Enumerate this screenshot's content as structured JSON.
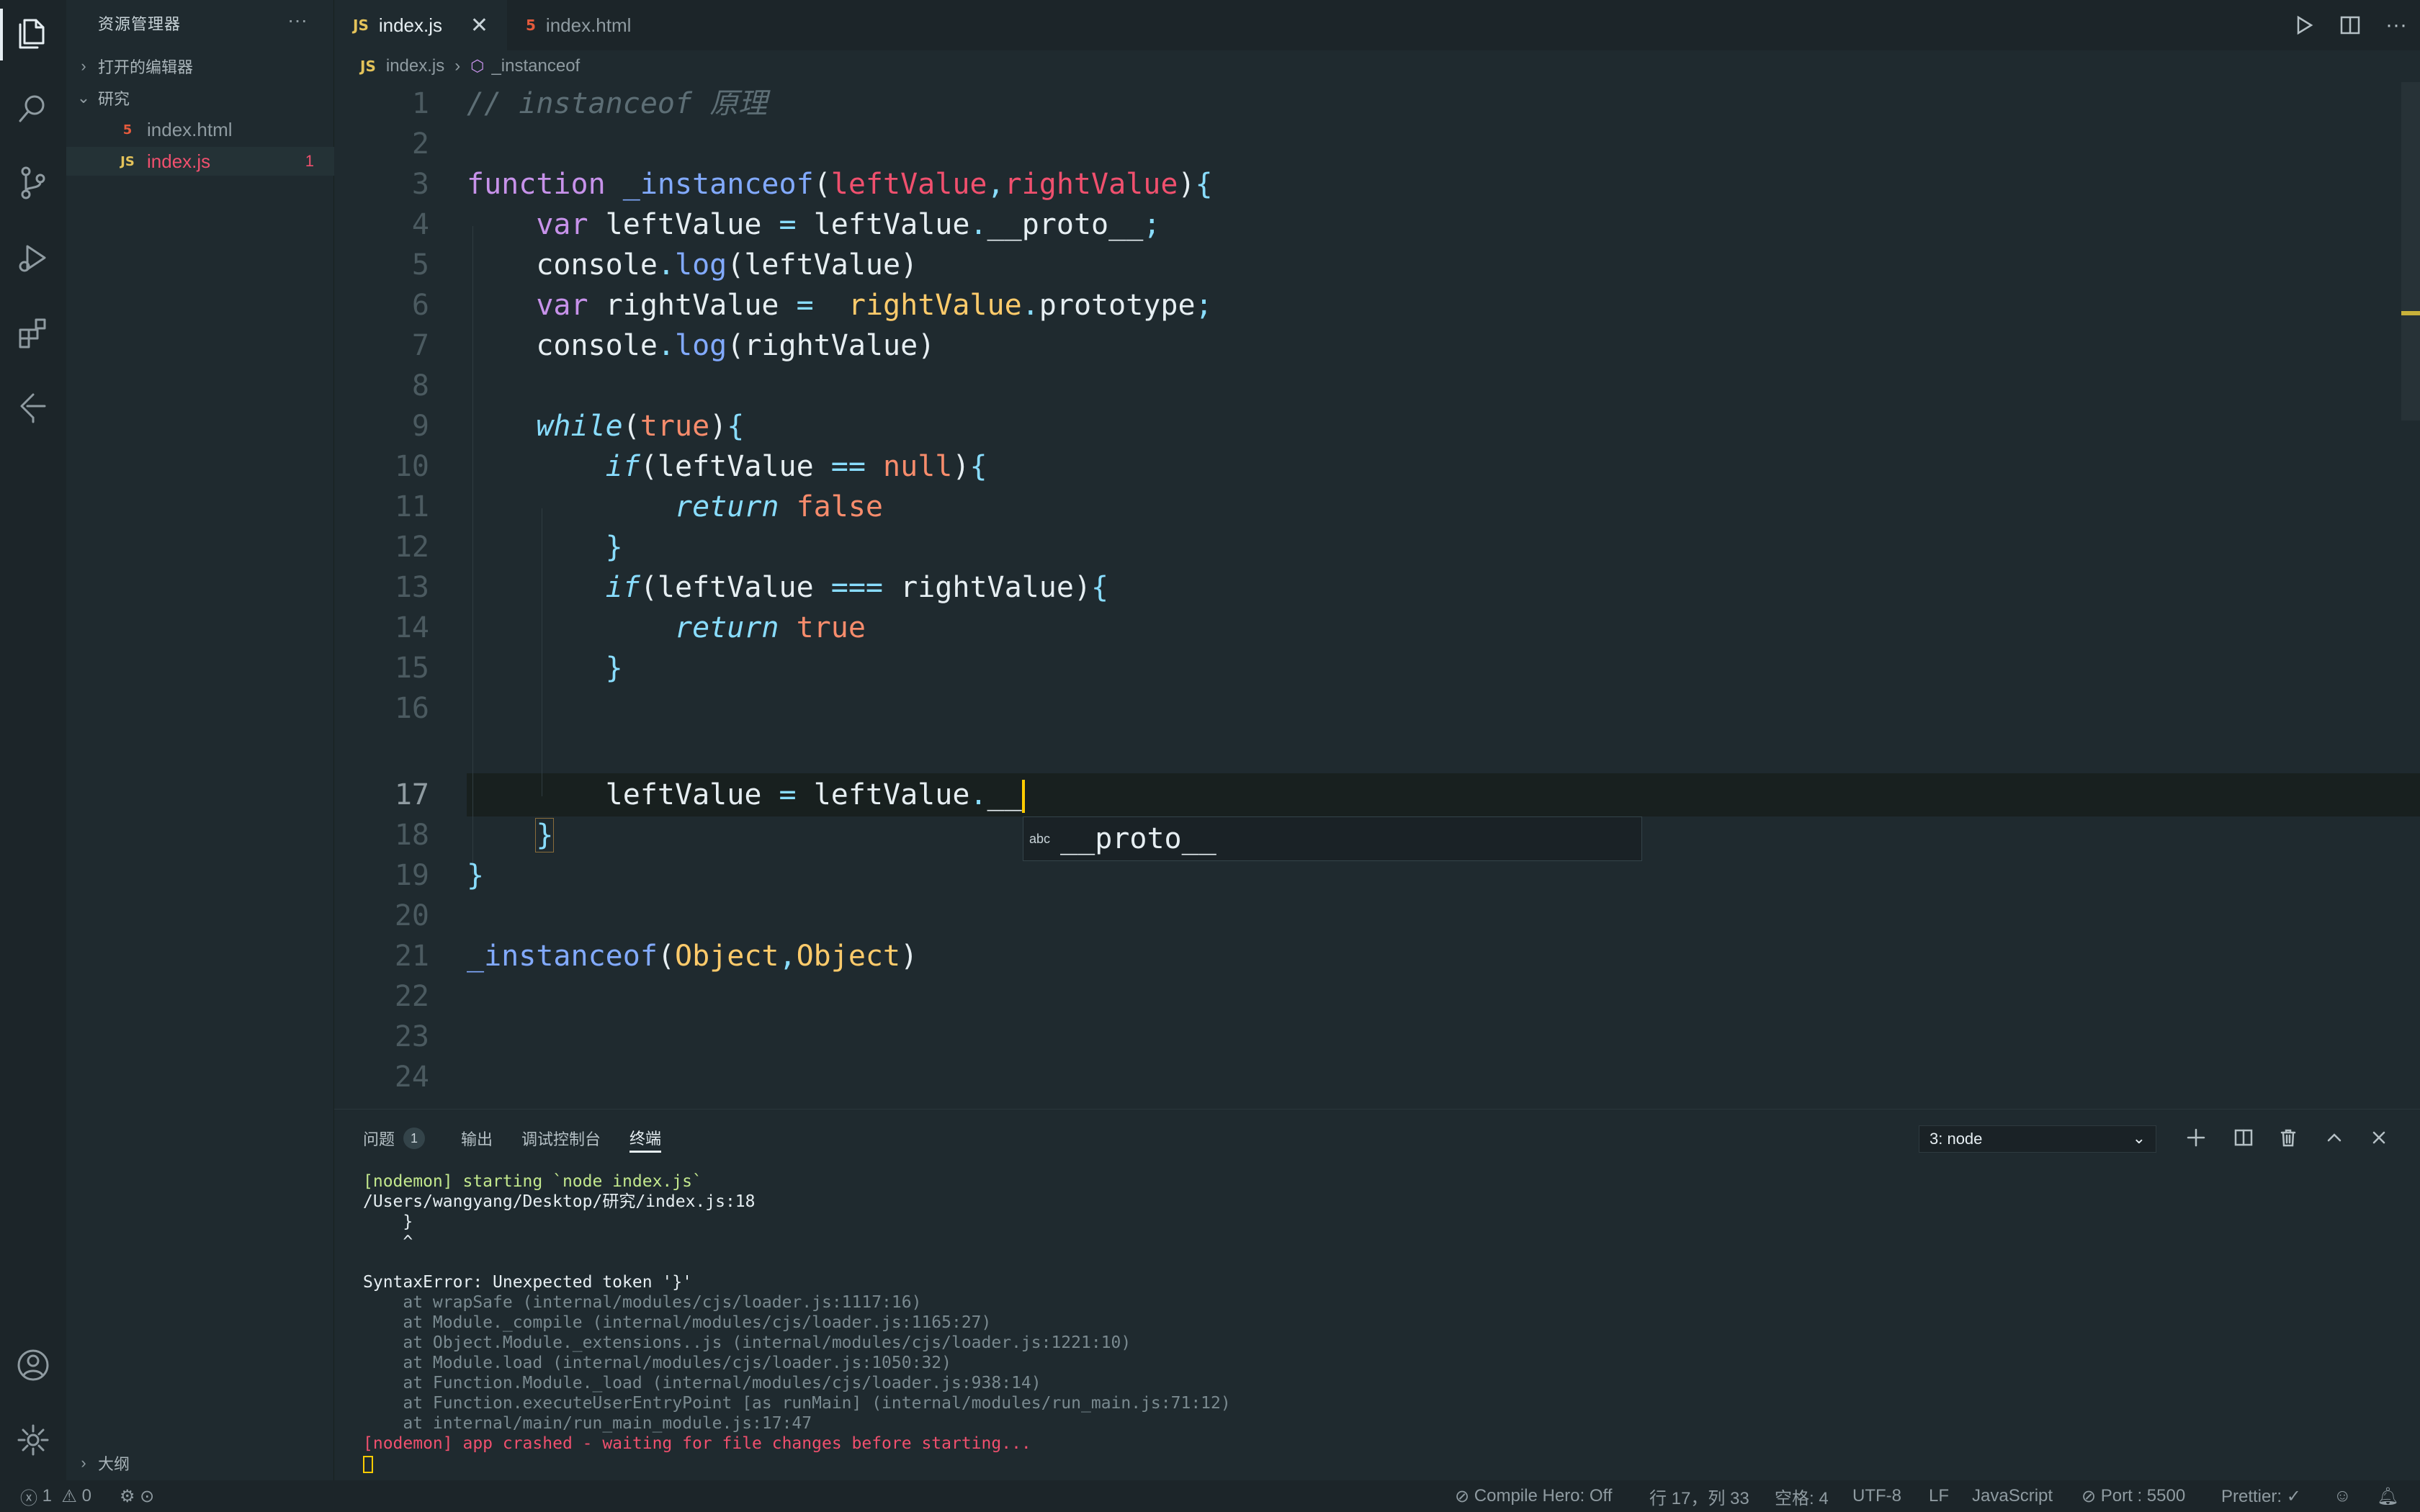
{
  "sidebar": {
    "title": "资源管理器",
    "more": "···",
    "open_editors": "打开的编辑器",
    "folder": "研究",
    "files": [
      {
        "badge": "5",
        "name": "index.html"
      },
      {
        "badge": "JS",
        "name": "index.js",
        "errors": "1"
      }
    ],
    "outline": "大纲"
  },
  "tabs": [
    {
      "badge": "JS",
      "label": "index.js",
      "close": "✕"
    },
    {
      "badge": "5",
      "label": "index.html"
    }
  ],
  "breadcrumb": {
    "badge": "JS",
    "file": "index.js",
    "symbol": "_instanceof"
  },
  "editor": {
    "line_numbers": [
      "1",
      "2",
      "3",
      "4",
      "5",
      "6",
      "7",
      "8",
      "9",
      "10",
      "11",
      "12",
      "13",
      "14",
      "15",
      "16",
      "17",
      "18",
      "19",
      "20",
      "21",
      "22",
      "23",
      "24"
    ],
    "tokens": {
      "l1": "// instanceof 原理",
      "function": "function",
      "fn_name": "_instanceof",
      "p_left": "leftValue",
      "p_right": "rightValue",
      "var": "var",
      "leftValue": "leftValue",
      "rightValue": "rightValue",
      "proto": "__proto__",
      "proto_partial": "__",
      "prototype": "prototype",
      "console": "console",
      "log": "log",
      "while": "while",
      "true": "true",
      "false": "false",
      "null": "null",
      "if": "if",
      "return": "return",
      "Object": "Object"
    },
    "suggestion": {
      "kind": "abc",
      "label": "__proto__"
    }
  },
  "panel": {
    "tabs": [
      {
        "label": "问题",
        "count": "1"
      },
      {
        "label": "输出"
      },
      {
        "label": "调试控制台"
      },
      {
        "label": "终端"
      }
    ],
    "terminal_select": "3: node",
    "terminal": [
      "[nodemon] starting `node index.js`",
      "/Users/wangyang/Desktop/研究/index.js:18",
      "    }",
      "    ^",
      "",
      "SyntaxError: Unexpected token '}'",
      "    at wrapSafe (internal/modules/cjs/loader.js:1117:16)",
      "    at Module._compile (internal/modules/cjs/loader.js:1165:27)",
      "    at Object.Module._extensions..js (internal/modules/cjs/loader.js:1221:10)",
      "    at Module.load (internal/modules/cjs/loader.js:1050:32)",
      "    at Function.Module._load (internal/modules/cjs/loader.js:938:14)",
      "    at Function.executeUserEntryPoint [as runMain] (internal/modules/run_main.js:71:12)",
      "    at internal/main/run_main_module.js:17:47",
      "[nodemon] app crashed - waiting for file changes before starting..."
    ]
  },
  "status": {
    "errors": "1",
    "warnings": "0",
    "compile_hero": "Compile Hero: Off",
    "position": "行 17，列 33",
    "spaces": "空格: 4",
    "encoding": "UTF-8",
    "eol": "LF",
    "language": "JavaScript",
    "port": "Port : 5500",
    "prettier": "Prettier: ✓"
  },
  "colors": {
    "accent_cursor": "#ffcc00",
    "error": "#f0506e",
    "js_badge": "#e4c35a",
    "html_badge": "#e45a3c"
  }
}
